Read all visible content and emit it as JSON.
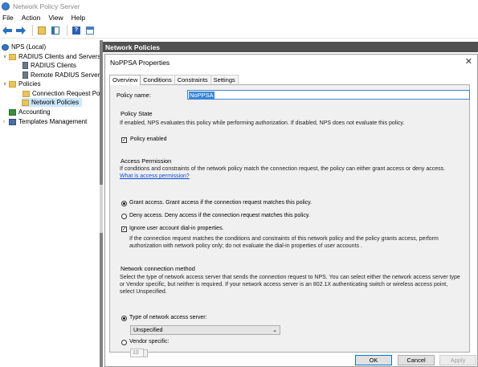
{
  "window": {
    "title": "Network Policy Server"
  },
  "menu": [
    "File",
    "Action",
    "View",
    "Help"
  ],
  "toolbar": {
    "icons": [
      "back-arrow-icon",
      "forward-arrow-icon",
      "up-folder-icon",
      "show-hide-tree-icon",
      "help-icon",
      "properties-icon"
    ]
  },
  "tree": {
    "root": "NPS (Local)",
    "radius_clients_servers": "RADIUS Clients and Servers",
    "radius_clients": "RADIUS Clients",
    "remote_radius": "Remote RADIUS Server",
    "policies": "Policies",
    "connection_request": "Connection Request Po",
    "network_policies": "Network Policies",
    "accounting": "Accounting",
    "templates": "Templates Management"
  },
  "right_panel": {
    "header": "Network Policies"
  },
  "dialog": {
    "title": "NoPPSA Properties",
    "close_glyph": "✕",
    "tabs": [
      "Overview",
      "Conditions",
      "Constraints",
      "Settings"
    ],
    "active_tab": "Overview",
    "policy_name_label": "Policy name:",
    "policy_name_value": "NoPPSA",
    "policy_state": {
      "label": "Policy State",
      "text": "If enabled, NPS evaluates this policy while performing authorization. If disabled, NPS does not evaluate this policy.",
      "enabled_label": "Policy enabled",
      "enabled": true
    },
    "access_permission": {
      "label": "Access Permission",
      "text": "If conditions and constraints of the network policy match the connection request, the policy can either grant access or deny access.",
      "link": "What is access permission?",
      "grant_label": "Grant access. Grant access if the connection request matches this policy.",
      "deny_label": "Deny access. Deny access if the connection request matches this policy.",
      "ignore_label": "Ignore user account dial-in properties.",
      "ignore_text": "If the connection request matches the conditions and constraints of this network policy and the policy grants access, perform authorization with network policy only; do not evaluate the dial-in properties of user accounts .",
      "selected": "grant",
      "ignore_checked": true
    },
    "network_connection": {
      "label": "Network connection method",
      "text": "Select the type of network access server that sends the connection request to NPS. You can select either the network access server type or Vendor specific, but neither is required.  If your network access server is an 802.1X authenticating switch or wireless access point, select Unspecified.",
      "type_label": "Type of network access server:",
      "type_value": "Unspecified",
      "vendor_label": "Vendor specific:",
      "vendor_value": "10",
      "selected": "type"
    },
    "buttons": {
      "ok": "OK",
      "cancel": "Cancel",
      "apply": "Apply"
    }
  }
}
